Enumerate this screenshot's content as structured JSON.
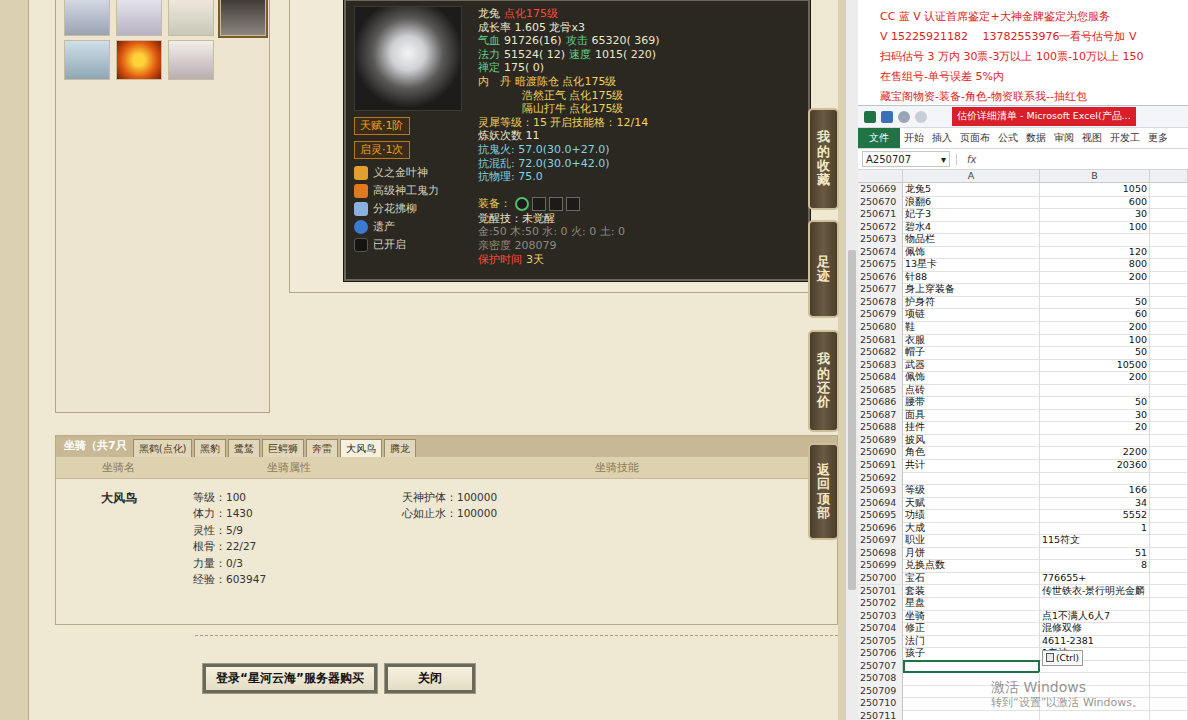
{
  "pet_avatars": [
    {
      "selected": false
    },
    {
      "selected": false
    },
    {
      "selected": false
    },
    {
      "selected": true
    },
    {
      "selected": false
    },
    {
      "selected": false
    },
    {
      "selected": false
    }
  ],
  "pet_tooltip": {
    "badges": [
      "天赋·1阶",
      "启灵·1次"
    ],
    "skills": [
      {
        "name": "义之金叶神"
      },
      {
        "name": "高级神工鬼力"
      },
      {
        "name": "分花拂柳"
      },
      {
        "name": "遗产"
      },
      {
        "name": "已开启"
      }
    ],
    "lines": [
      {
        "kind": "text",
        "segments": [
          {
            "text": "龙兔",
            "kind": "white"
          },
          {
            "text": "点化175级",
            "kind": "red"
          }
        ]
      },
      {
        "kind": "text",
        "segments": [
          {
            "text": "成长率 1.605 龙骨x3",
            "kind": "white"
          }
        ]
      },
      {
        "kind": "text",
        "segments": [
          {
            "text": "气血",
            "kind": "green"
          },
          {
            "text": "91726(16)",
            "kind": "white"
          },
          {
            "text": "攻击",
            "kind": "green"
          },
          {
            "text": "65320( 369)",
            "kind": "white"
          }
        ]
      },
      {
        "kind": "text",
        "segments": [
          {
            "text": "法力",
            "kind": "green"
          },
          {
            "text": "51524( 12)",
            "kind": "white"
          },
          {
            "text": "速度",
            "kind": "green"
          },
          {
            "text": "1015( 220)",
            "kind": "white"
          }
        ]
      },
      {
        "kind": "text",
        "segments": [
          {
            "text": "禅定",
            "kind": "green"
          },
          {
            "text": "175( 0)",
            "kind": "white"
          }
        ]
      },
      {
        "kind": "text",
        "segments": [
          {
            "text": "内　丹",
            "kind": "yellow"
          },
          {
            "text": "暗渡陈仓 点化175级",
            "kind": "yellow"
          }
        ]
      },
      {
        "kind": "indent",
        "segments": [
          {
            "text": "浩然正气 点化175级",
            "kind": "yellow"
          }
        ]
      },
      {
        "kind": "indent",
        "segments": [
          {
            "text": "隔山打牛 点化175级",
            "kind": "yellow"
          }
        ]
      },
      {
        "kind": "text",
        "segments": [
          {
            "text": "灵犀等级：15 开启技能格：12/14",
            "kind": "yellow"
          }
        ]
      },
      {
        "kind": "text",
        "segments": [
          {
            "text": "炼妖次数 11",
            "kind": "white"
          }
        ]
      },
      {
        "kind": "text",
        "segments": [
          {
            "text": "抗鬼火: 57.0(30.0+27.0)",
            "kind": "cyan"
          }
        ]
      },
      {
        "kind": "text",
        "segments": [
          {
            "text": "抗混乱: 72.0(30.0+42.0)",
            "kind": "cyan"
          }
        ]
      },
      {
        "kind": "text",
        "segments": [
          {
            "text": "抗物理: 75.0",
            "kind": "cyan"
          }
        ]
      },
      {
        "kind": "equip",
        "segments": [
          {
            "text": "装备：",
            "kind": "yellow"
          }
        ]
      },
      {
        "kind": "text",
        "segments": [
          {
            "text": "觉醒技：未觉醒",
            "kind": "white"
          }
        ]
      },
      {
        "kind": "text",
        "segments": [
          {
            "text": "金:50 木:50 水: 0 火: 0 土: 0",
            "kind": "grey"
          }
        ]
      },
      {
        "kind": "text",
        "segments": [
          {
            "text": "亲密度 208079",
            "kind": "grey"
          }
        ]
      },
      {
        "kind": "text",
        "segments": [
          {
            "text": "保护时间",
            "kind": "red"
          },
          {
            "text": "3天",
            "kind": "yellow"
          }
        ]
      }
    ]
  },
  "side_buttons": [
    "我的收藏",
    "足迹",
    "我的还价",
    "返回顶部"
  ],
  "mounts": {
    "title": "坐骑（共7只",
    "tabs": [
      {
        "label": "黑鹤(点化)",
        "selected": false
      },
      {
        "label": "黑豹",
        "selected": false
      },
      {
        "label": "鹭鸶",
        "selected": false
      },
      {
        "label": "巨鳄狮",
        "selected": false
      },
      {
        "label": "奔雷",
        "selected": false
      },
      {
        "label": "大风鸟",
        "selected": true
      },
      {
        "label": "腾龙",
        "selected": false
      }
    ],
    "headers": [
      "坐骑名",
      "坐骑属性",
      "坐骑技能"
    ],
    "name": "大风鸟",
    "attributes": [
      "等级：100",
      "体力：1430",
      "灵性：5/9",
      "根骨：22/27",
      "力量：0/3",
      "经验：603947"
    ],
    "skills": [
      "天神护体：100000",
      "心如止水：100000"
    ]
  },
  "buttons": [
    "登录“星河云海”服务器购买",
    "关闭"
  ],
  "ad_lines": [
    "CC 蓝 V 认证首席鉴定+大神金牌鉴定为您服务",
    "V 15225921182　 13782553976一看号估号加 V",
    "扫码估号 3 万内 30票-3万以上 100票-10万以上 150",
    "在售组号-单号误差 5%内",
    "藏宝阁物资-装备-角色-物资联系我--抽红包"
  ],
  "excel": {
    "title": "估价详细清单 - Microsoft Excel(产品...",
    "tabs": [
      {
        "label": "文件",
        "selected": true
      },
      {
        "label": "开始",
        "selected": false
      },
      {
        "label": "插入",
        "selected": false
      },
      {
        "label": "页面布",
        "selected": false
      },
      {
        "label": "公式",
        "selected": false
      },
      {
        "label": "数据",
        "selected": false
      },
      {
        "label": "审阅",
        "selected": false
      },
      {
        "label": "视图",
        "selected": false
      },
      {
        "label": "开发工",
        "selected": false
      },
      {
        "label": "更多",
        "selected": false
      }
    ],
    "name_box": "A250707",
    "name_box_arrow": "▾",
    "fx": "fx",
    "columns": [
      "A",
      "B"
    ],
    "paste_badge": "(Ctrl)",
    "rows": [
      {
        "n": "250669",
        "a": "龙兔5",
        "b": "1050",
        "kind": "number",
        "selected": false
      },
      {
        "n": "250670",
        "a": "浪翻6",
        "b": "600",
        "kind": "number",
        "selected": false
      },
      {
        "n": "250671",
        "a": "妃子3",
        "b": "30",
        "kind": "number",
        "selected": false
      },
      {
        "n": "250672",
        "a": "碧水4",
        "b": "100",
        "kind": "number",
        "selected": false
      },
      {
        "n": "250673",
        "a": "物品栏",
        "b": "",
        "kind": "text",
        "selected": false
      },
      {
        "n": "250674",
        "a": "佩饰",
        "b": "120",
        "kind": "number",
        "selected": false
      },
      {
        "n": "250675",
        "a": "13星卡",
        "b": "800",
        "kind": "number",
        "selected": false
      },
      {
        "n": "250676",
        "a": "针88",
        "b": "200",
        "kind": "number",
        "selected": false
      },
      {
        "n": "250677",
        "a": "身上穿装备",
        "b": "",
        "kind": "text",
        "selected": false
      },
      {
        "n": "250678",
        "a": "护身符",
        "b": "50",
        "kind": "number",
        "selected": false
      },
      {
        "n": "250679",
        "a": "项链",
        "b": "60",
        "kind": "number",
        "selected": false
      },
      {
        "n": "250680",
        "a": "鞋",
        "b": "200",
        "kind": "number",
        "selected": false
      },
      {
        "n": "250681",
        "a": "衣服",
        "b": "100",
        "kind": "number",
        "selected": false
      },
      {
        "n": "250682",
        "a": "帽子",
        "b": "50",
        "kind": "number",
        "selected": false
      },
      {
        "n": "250683",
        "a": "武器",
        "b": "10500",
        "kind": "number",
        "selected": false
      },
      {
        "n": "250684",
        "a": "佩饰",
        "b": "200",
        "kind": "number",
        "selected": false
      },
      {
        "n": "250685",
        "a": "点砖",
        "b": "",
        "kind": "text",
        "selected": false
      },
      {
        "n": "250686",
        "a": "腰带",
        "b": "50",
        "kind": "number",
        "selected": false
      },
      {
        "n": "250687",
        "a": "面具",
        "b": "30",
        "kind": "number",
        "selected": false
      },
      {
        "n": "250688",
        "a": "挂件",
        "b": "20",
        "kind": "number",
        "selected": false
      },
      {
        "n": "250689",
        "a": "披风",
        "b": "",
        "kind": "text",
        "selected": false
      },
      {
        "n": "250690",
        "a": "角色",
        "b": "2200",
        "kind": "number",
        "selected": false
      },
      {
        "n": "250691",
        "a": "共计",
        "b": "20360",
        "kind": "number",
        "selected": false
      },
      {
        "n": "250692",
        "a": "",
        "b": "",
        "kind": "text",
        "selected": false
      },
      {
        "n": "250693",
        "a": "等级",
        "b": "166",
        "kind": "number",
        "selected": false
      },
      {
        "n": "250694",
        "a": "天赋",
        "b": "34",
        "kind": "number",
        "selected": false
      },
      {
        "n": "250695",
        "a": "功绩",
        "b": "5552",
        "kind": "number",
        "selected": false
      },
      {
        "n": "250696",
        "a": "大成",
        "b": "1",
        "kind": "number",
        "selected": false
      },
      {
        "n": "250697",
        "a": "职业",
        "b": "115符文",
        "kind": "text",
        "selected": false
      },
      {
        "n": "250698",
        "a": "月饼",
        "b": "51",
        "kind": "number",
        "selected": false
      },
      {
        "n": "250699",
        "a": "兑换点数",
        "b": "8",
        "kind": "number",
        "selected": false
      },
      {
        "n": "250700",
        "a": "宝石",
        "b": "776655+",
        "kind": "text",
        "selected": false
      },
      {
        "n": "250701",
        "a": "套装",
        "b": "传世铁衣-景行明光金麟",
        "kind": "text",
        "selected": false
      },
      {
        "n": "250702",
        "a": "星盘",
        "b": "",
        "kind": "text",
        "selected": false
      },
      {
        "n": "250703",
        "a": "坐骑",
        "b": "点1不满人6人7",
        "kind": "text",
        "selected": false
      },
      {
        "n": "250704",
        "a": "修正",
        "b": "混修双修",
        "kind": "text",
        "selected": false
      },
      {
        "n": "250705",
        "a": "法门",
        "b": "4611-2381",
        "kind": "text",
        "selected": false
      },
      {
        "n": "250706",
        "a": "孩子",
        "b": "1老神",
        "kind": "text",
        "selected": false
      },
      {
        "n": "250707",
        "a": "",
        "b": "",
        "kind": "text",
        "selected": true
      },
      {
        "n": "250708",
        "a": "",
        "b": "",
        "kind": "text",
        "selected": false
      },
      {
        "n": "250709",
        "a": "",
        "b": "",
        "kind": "text",
        "selected": false
      },
      {
        "n": "250710",
        "a": "",
        "b": "",
        "kind": "text",
        "selected": false
      },
      {
        "n": "250711",
        "a": "",
        "b": "",
        "kind": "text",
        "selected": false
      }
    ]
  },
  "watermark": [
    "激活 Windows",
    "转到“设置”以激活 Windows。"
  ]
}
